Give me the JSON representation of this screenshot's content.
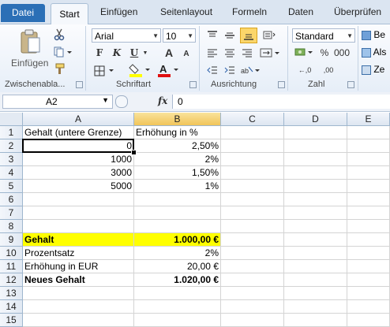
{
  "tabs": {
    "file": "Datei",
    "start": "Start",
    "insert": "Einfügen",
    "layout": "Seitenlayout",
    "formulas": "Formeln",
    "data": "Daten",
    "review": "Überprüfen"
  },
  "ribbon": {
    "paste_label": "Einfügen",
    "font_name": "Arial",
    "font_size": "10",
    "number_format": "Standard",
    "bold": "F",
    "italic": "K",
    "underline": "U",
    "grow": "A",
    "shrink": "A",
    "fontcolor": "A",
    "percent": "%",
    "thousands": "000",
    "dec_inc": "←,0",
    "dec_dec": ",00",
    "cut_right_1": "Be",
    "cut_right_2": "Als",
    "cut_right_3": "Ze",
    "groups": {
      "clipboard": "Zwischenabla...",
      "font": "Schriftart",
      "alignment": "Ausrichtung",
      "number": "Zahl"
    }
  },
  "formula_bar": {
    "name_box": "A2",
    "fx": "fx",
    "content": "0"
  },
  "columns": [
    "A",
    "B",
    "C",
    "D",
    "E"
  ],
  "rows": [
    "1",
    "2",
    "3",
    "4",
    "5",
    "6",
    "7",
    "8",
    "9",
    "10",
    "11",
    "12",
    "13",
    "14",
    "15"
  ],
  "cells": {
    "A1": "Gehalt (untere Grenze)",
    "B1": "Erhöhung in %",
    "A2": "0",
    "B2": "2,50%",
    "A3": "1000",
    "B3": "2%",
    "A4": "3000",
    "B4": "1,50%",
    "A5": "5000",
    "B5": "1%",
    "A9": "Gehalt",
    "B9": "1.000,00 €",
    "A10": "Prozentsatz",
    "B10": "2%",
    "A11": "Erhöhung in EUR",
    "B11": "20,00 €",
    "A12": "Neues Gehalt",
    "B12": "1.020,00 €"
  },
  "colors": {
    "highlight": "#ffff00",
    "file_tab": "#2b6fb6",
    "selection": "#000000"
  }
}
